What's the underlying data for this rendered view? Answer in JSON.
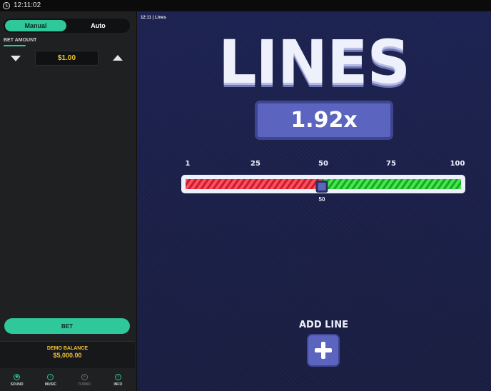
{
  "status_bar": {
    "time": "12:11:02"
  },
  "sidebar": {
    "mode_tabs": [
      {
        "label": "Manual",
        "active": true
      },
      {
        "label": "Auto",
        "active": false
      }
    ],
    "bet_amount_label": "BET AMOUNT",
    "bet_amount_value": "$1.00",
    "bet_button_label": "BET",
    "balance_label": "DEMO BALANCE",
    "balance_value": "$5,000.00",
    "nav": [
      {
        "label": "SOUND",
        "icon": "sound-icon",
        "enabled": true
      },
      {
        "label": "MUSIC",
        "icon": "music-icon",
        "enabled": true
      },
      {
        "label": "TURBO",
        "icon": "turbo-icon",
        "enabled": false
      },
      {
        "label": "INFO",
        "icon": "info-icon",
        "enabled": true
      }
    ]
  },
  "game": {
    "header": "12:11  |  Lines",
    "title": "LINES",
    "multiplier": "1.92x",
    "slider": {
      "ticks": [
        "1",
        "25",
        "50",
        "75",
        "100"
      ],
      "min": 1,
      "max": 100,
      "value": 50,
      "value_label": "50"
    },
    "add_line_label": "ADD LINE"
  },
  "colors": {
    "accent": "#2ec89a",
    "gold": "#f0c232",
    "game_bg": "#1c2147",
    "panel": "#5b65c0",
    "lose": "#ff4d5c",
    "win": "#43e84b"
  }
}
